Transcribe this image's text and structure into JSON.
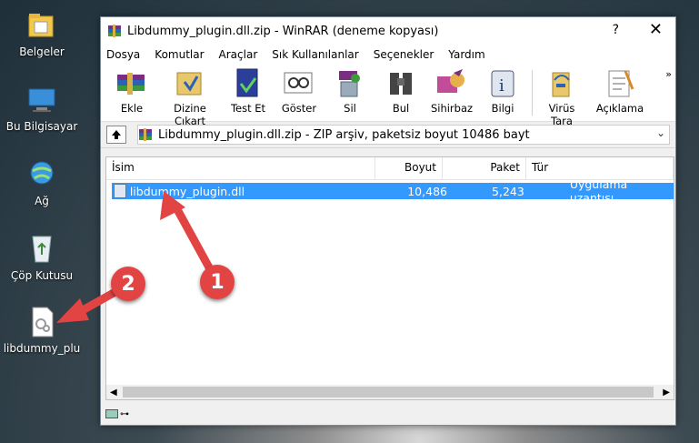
{
  "desktop": {
    "icons": [
      {
        "label": "Belgeler",
        "icon": "folder-icon"
      },
      {
        "label": "Bu Bilgisayar",
        "icon": "computer-icon"
      },
      {
        "label": "Ağ",
        "icon": "network-icon"
      },
      {
        "label": "Çöp Kutusu",
        "icon": "recycle-bin-icon"
      },
      {
        "label": "libdummy_plu",
        "icon": "dll-file-icon"
      }
    ]
  },
  "window": {
    "title": "Libdummy_plugin.dll.zip - WinRAR (deneme kopyası)",
    "help": "?",
    "close": "✕"
  },
  "menu": [
    "Dosya",
    "Komutlar",
    "Araçlar",
    "Sık Kullanılanlar",
    "Seçenekler",
    "Yardım"
  ],
  "toolbar": [
    {
      "label": "Ekle",
      "icon": "add-archive-icon"
    },
    {
      "label": "Dizine Çıkart",
      "icon": "extract-icon"
    },
    {
      "label": "Test Et",
      "icon": "test-icon"
    },
    {
      "label": "Göster",
      "icon": "view-icon"
    },
    {
      "label": "Sil",
      "icon": "delete-icon"
    },
    {
      "label": "Bul",
      "icon": "find-icon"
    },
    {
      "label": "Sihirbaz",
      "icon": "wizard-icon"
    },
    {
      "label": "Bilgi",
      "icon": "info-icon"
    },
    {
      "label": "Virüs Tara",
      "icon": "virus-scan-icon"
    },
    {
      "label": "Açıklama",
      "icon": "comment-icon"
    }
  ],
  "toolbar_more": "»",
  "path": "Libdummy_plugin.dll.zip - ZIP arşiv, paketsiz boyut 10486 bayt",
  "columns": {
    "name": "İsim",
    "size": "Boyut",
    "packed": "Paket",
    "type": "Tür"
  },
  "files": [
    {
      "name": "libdummy_plugin.dll",
      "size": "10,486",
      "packed": "5,243",
      "type": "Uygulama uzantısı"
    }
  ],
  "callouts": {
    "one": "1",
    "two": "2"
  },
  "colors": {
    "selection": "#3399ff",
    "callout": "#e24444"
  }
}
